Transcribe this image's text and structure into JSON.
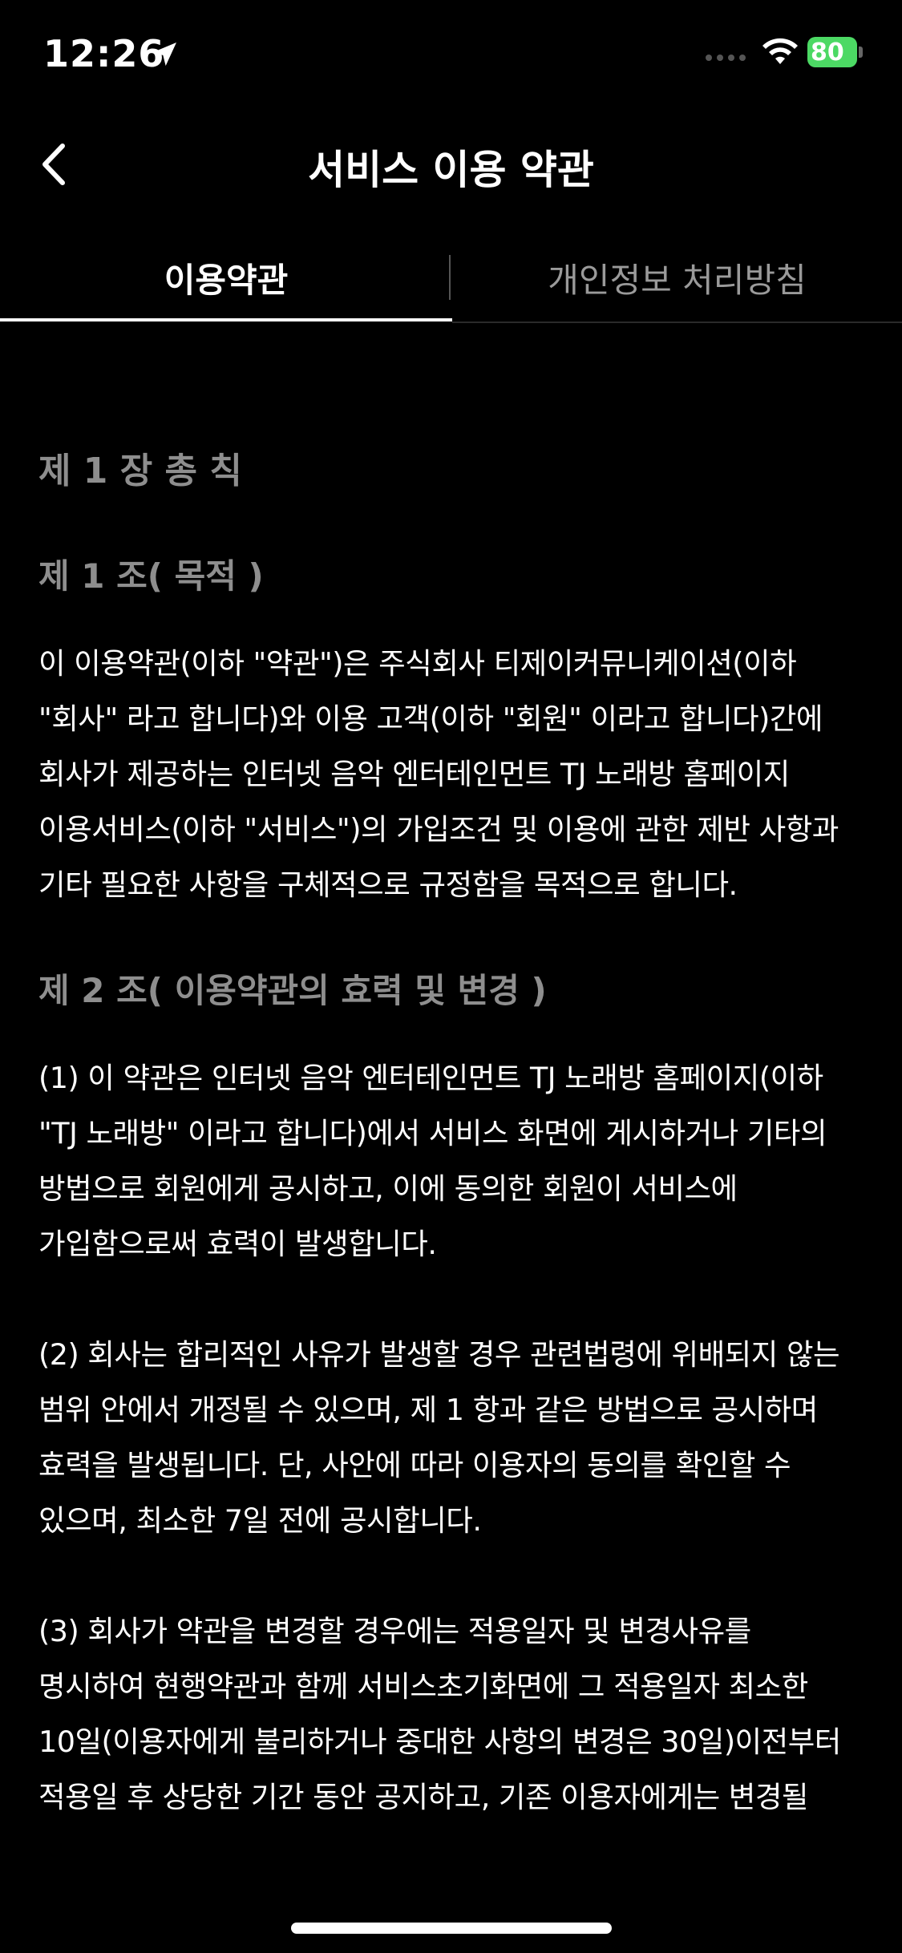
{
  "status_bar": {
    "time": "12:26",
    "battery": "80",
    "icons": [
      "location-arrow-icon",
      "signal-dots-icon",
      "wifi-icon",
      "battery-charging-icon"
    ]
  },
  "nav": {
    "title": "서비스 이용 약관",
    "back_icon": "chevron-left-icon"
  },
  "tabs": [
    {
      "label": "이용약관",
      "active": true
    },
    {
      "label": "개인정보 처리방침",
      "active": false
    }
  ],
  "content": {
    "chapter": "제 1 장 총 칙",
    "articles": [
      {
        "title": "제 1 조( 목적 )",
        "paragraphs": [
          "이 이용약관(이하 \"약관\")은 주식회사 티제이커뮤니케이션(이하\n\"회사\" 라고 합니다)와 이용 고객(이하 \"회원\" 이라고 합니다)간에\n회사가 제공하는 인터넷 음악 엔터테인먼트 TJ 노래방 홈페이지\n이용서비스(이하 \"서비스\")의 가입조건 및 이용에 관한 제반 사항과\n기타 필요한 사항을 구체적으로 규정함을 목적으로 합니다."
        ]
      },
      {
        "title": "제 2 조( 이용약관의 효력 및 변경 )",
        "paragraphs": [
          "(1) 이 약관은 인터넷 음악 엔터테인먼트 TJ 노래방 홈페이지(이하\n\"TJ 노래방\" 이라고 합니다)에서 서비스 화면에 게시하거나 기타의\n방법으로 회원에게 공시하고, 이에 동의한 회원이 서비스에\n가입함으로써 효력이 발생합니다.",
          "(2) 회사는 합리적인 사유가 발생할 경우 관련법령에 위배되지 않는\n범위 안에서 개정될 수 있으며, 제 1 항과 같은 방법으로 공시하며\n효력을 발생됩니다. 단, 사안에 따라 이용자의 동의를 확인할 수\n있으며, 최소한 7일 전에 공시합니다.",
          "(3) 회사가 약관을 변경할 경우에는 적용일자 및 변경사유를\n명시하여 현행약관과 함께 서비스초기화면에 그 적용일자 최소한\n10일(이용자에게 불리하거나 중대한 사항의 변경은 30일)이전부터\n적용일 후 상당한 기간 동안 공지하고, 기존 이용자에게는 변경될"
        ]
      }
    ]
  },
  "colors": {
    "background": "#000000",
    "heading_gray": "#8e8e8e",
    "inactive_tab": "#9a9a9a",
    "battery_green": "#4cd964"
  }
}
